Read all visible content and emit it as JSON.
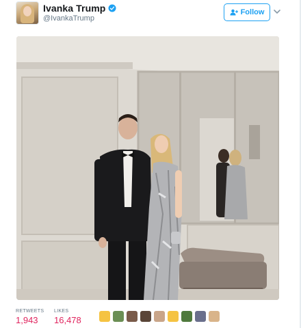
{
  "tweet": {
    "display_name": "Ivanka Trump",
    "handle": "@IvankaTrump",
    "verified": true,
    "follow_label": "Follow"
  },
  "icons": {
    "verified": "verified-badge-icon",
    "follow": "person-add-icon",
    "caret": "chevron-down-icon"
  },
  "stats": {
    "retweets_label": "RETWEETS",
    "retweets_value": "1,943",
    "likes_label": "LIKES",
    "likes_value": "16,478"
  },
  "likers": [
    "#f5c342",
    "#6b8f54",
    "#7a5b4a",
    "#5a4538",
    "#c9a589",
    "#f5c342",
    "#4f7a3d",
    "#6a6f8c",
    "#d9b48a"
  ],
  "colors": {
    "accent": "#1da1f2",
    "likes_pink": "#e0245e",
    "muted_text": "#657786"
  }
}
